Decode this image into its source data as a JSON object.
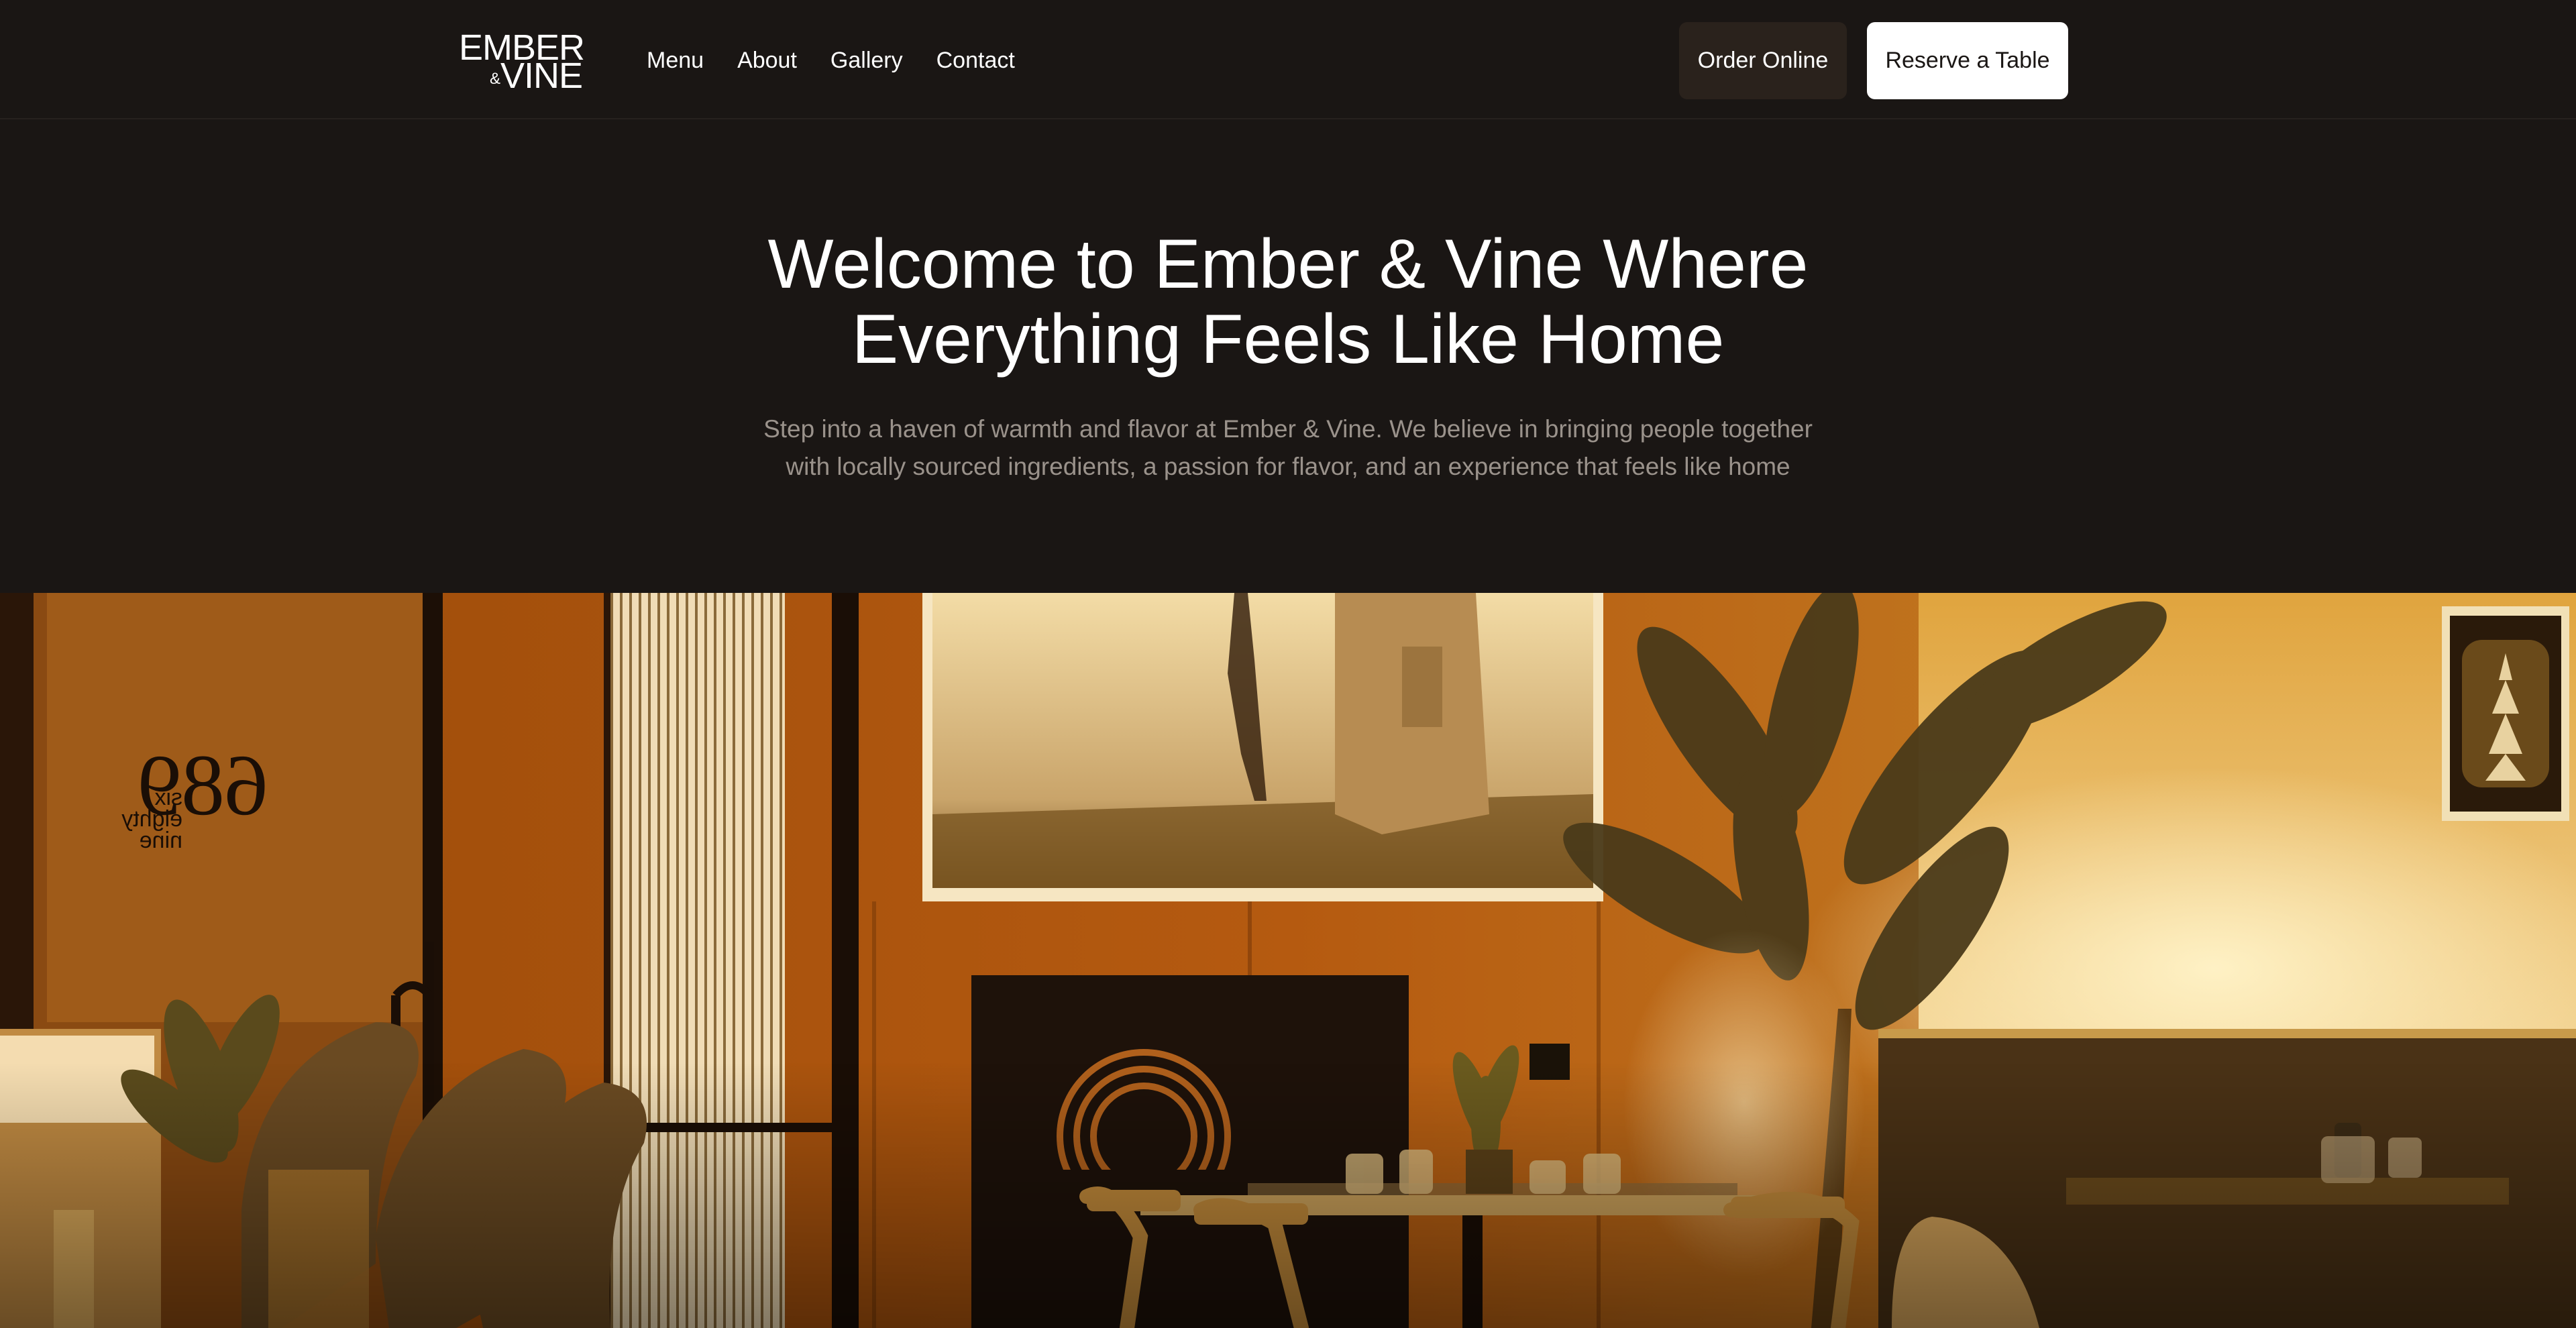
{
  "brand": {
    "logo_line1": "EMBER",
    "logo_amp": "&",
    "logo_line2": "VINE"
  },
  "nav": {
    "items": [
      {
        "label": "Menu"
      },
      {
        "label": "About"
      },
      {
        "label": "Gallery"
      },
      {
        "label": "Contact"
      }
    ]
  },
  "actions": {
    "order_label": "Order Online",
    "reserve_label": "Reserve a Table"
  },
  "hero": {
    "title_line1": "Welcome to Ember & Vine Where",
    "title_line2": "Everything Feels Like Home",
    "subtitle_line1": "Step into a haven of warmth and flavor at Ember & Vine. We believe in bringing people together",
    "subtitle_line2": "with locally sourced ingredients, a passion for flavor, and an experience that feels like home"
  },
  "photo": {
    "door_number": "689",
    "door_text_line1": "six",
    "door_text_line2": "eighty",
    "door_text_line3": "nine"
  },
  "colors": {
    "background": "#1a1614",
    "order_button_bg": "#2a221c",
    "reserve_button_bg": "#ffffff",
    "subtitle_text": "#9a928b",
    "photo_tone": "#b0600f"
  }
}
